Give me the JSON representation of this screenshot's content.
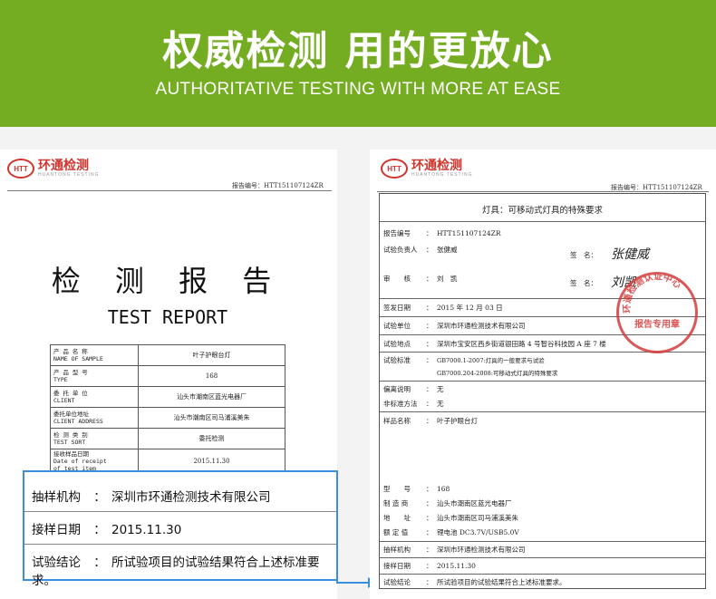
{
  "banner": {
    "title": "权威检测 用的更放心",
    "subtitle": "AUTHORITATIVE TESTING WITH MORE AT EASE",
    "bg_color": "#74ad22"
  },
  "logo": {
    "badge": "HTT",
    "name_cn": "环通检测",
    "name_en": "HUANTONG TESTING",
    "color": "#d0342c"
  },
  "left_doc": {
    "report_no": "报告编号：HTT151107124ZR",
    "title_cn": "检 测 报 告",
    "title_en": "TEST REPORT",
    "rows": [
      {
        "label_cn": "产 品 名 称",
        "label_en": "NAME OF SAMPLE",
        "value": "叶子护眼台灯"
      },
      {
        "label_cn": "产 品 型 号",
        "label_en": "TYPE",
        "value": "168"
      },
      {
        "label_cn": "委 托 单 位",
        "label_en": "CLIENT",
        "value": "汕头市潮南区蓝光电器厂"
      },
      {
        "label_cn": "委托单位地址",
        "label_en": "CLIENT ADDRESS",
        "value": "汕头市潮南区司马浦溪美朱"
      },
      {
        "label_cn": "检 测 类 别",
        "label_en": "TEST SORT",
        "value": "委托检测"
      },
      {
        "label_cn": "接收样品日期",
        "label_en": "Date of receipt",
        "value": "2015.11.30"
      }
    ],
    "row_last_extra": "of test item"
  },
  "zoom_box": {
    "rows": [
      {
        "label": "抽样机构",
        "colon": "：",
        "value": "深圳市环通检测技术有限公司"
      },
      {
        "label": "接样日期",
        "colon": "：",
        "value": "2015.11.30"
      },
      {
        "label": "试验结论",
        "colon": "：",
        "value": "所试验项目的试验结果符合上述标准要求。"
      }
    ],
    "border_color": "#3a8fdc"
  },
  "right_doc": {
    "report_no": "报告编号：HTT151107124ZR",
    "table_title": "灯具：可移动式灯具的特殊要求",
    "rows": {
      "report_no": {
        "label": "报告编号",
        "value": "HTT151107124ZR"
      },
      "tester": {
        "label": "试验负责人",
        "value": "张健威",
        "sign_label": "签　名：",
        "signature": "张健威"
      },
      "reviewer": {
        "label": "审　　核",
        "value": "刘　凯",
        "sign_label": "签　名：",
        "signature": "刘凯"
      },
      "issue_date": {
        "label": "签发日期",
        "value": "2015 年 12 月 03 日"
      },
      "test_unit": {
        "label": "试验单位",
        "value": "深圳市环通检测技术有限公司"
      },
      "test_site": {
        "label": "试验地点",
        "value": "深圳市宝安区西乡街道银田路 4 号智谷科技园 A 座 7 楼"
      },
      "standard": {
        "label": "试验标准",
        "lines": [
          "GB7000.1-2007:灯具的一般要求与试验",
          "GB7000.204-2008:可移动式灯具的特殊要求"
        ]
      },
      "deviation": {
        "label": "偏离说明",
        "value": "无"
      },
      "non_std": {
        "label": "非标准方法",
        "value": "无"
      },
      "sample_name": {
        "label": "样品名称",
        "value": "叶子护眼台灯"
      },
      "model": {
        "label": "型　　号",
        "value": "168"
      },
      "manufacturer": {
        "label": "制 造 商",
        "value": "汕头市潮南区蓝光电器厂"
      },
      "address": {
        "label": "地　　址",
        "value": "汕头市潮南区司马浦溪美朱"
      },
      "rating": {
        "label": "额 定 值",
        "value": "锂电池 DC3.7V/USB5.0V"
      },
      "sampling_org": {
        "label": "抽样机构",
        "value": "深圳市环通检测技术有限公司"
      },
      "receive_date": {
        "label": "接样日期",
        "value": "2015.11.30"
      },
      "conclusion": {
        "label": "试验结论",
        "value": "所试验项目的试验结果符合上述标准要求。"
      }
    },
    "colon": "：",
    "stamp": {
      "ring_text": "环通检测认证中心",
      "center_text": "报告专用章",
      "color": "#d33b3b"
    }
  }
}
